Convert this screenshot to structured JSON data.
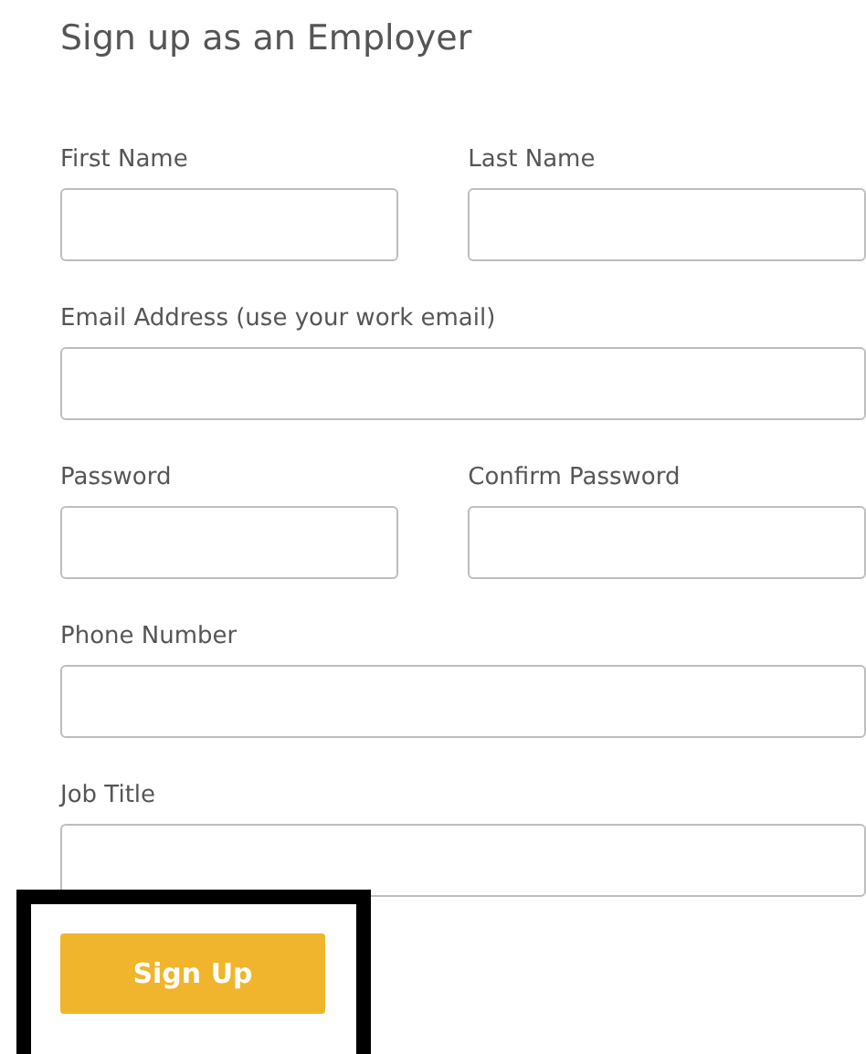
{
  "title": "Sign up as an Employer",
  "rows": [
    {
      "fields": [
        {
          "label": "First Name",
          "kind": "half"
        },
        {
          "label": "Last Name",
          "kind": "half"
        }
      ]
    },
    {
      "fields": [
        {
          "label": "Email Address (use your work email)",
          "kind": "full"
        }
      ]
    },
    {
      "fields": [
        {
          "label": "Password",
          "kind": "half"
        },
        {
          "label": "Confirm Password",
          "kind": "half"
        }
      ]
    },
    {
      "fields": [
        {
          "label": "Phone Number",
          "kind": "full"
        }
      ]
    },
    {
      "fields": [
        {
          "label": "Job Title",
          "kind": "full"
        }
      ]
    }
  ],
  "submit": {
    "label": "Sign Up",
    "highlighted": true
  }
}
